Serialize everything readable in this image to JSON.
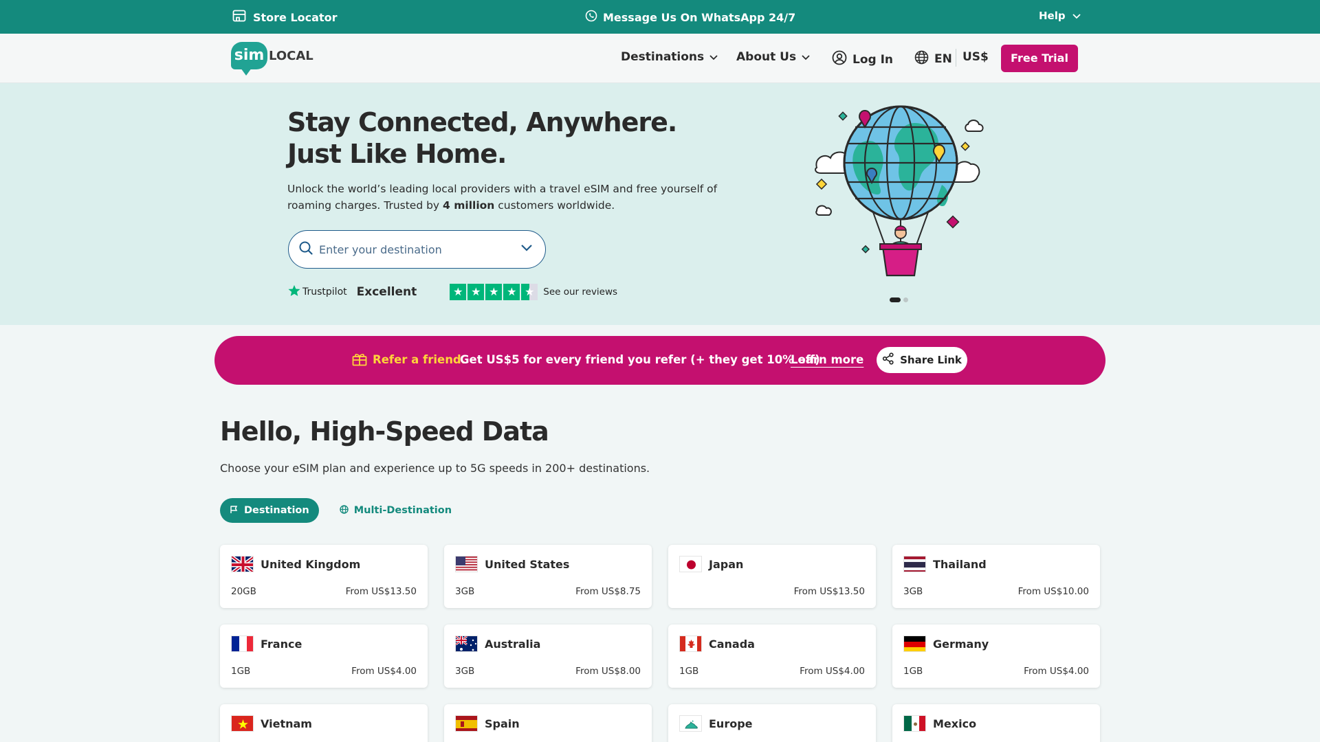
{
  "topbar": {
    "store_locator": "Store Locator",
    "whatsapp": "Message Us On WhatsApp 24/7",
    "help": "Help"
  },
  "nav": {
    "logo_sim": "sim",
    "logo_local": "LOCAL",
    "destinations": "Destinations",
    "about_us": "About Us",
    "log_in": "Log In",
    "language": "EN",
    "currency": "US$",
    "free_trial": "Free Trial"
  },
  "hero": {
    "title": "Stay Connected, Anywhere.  Just Like Home.",
    "sub_before": "Unlock the world’s leading local providers with a travel eSIM and free yourself of roaming charges. Trusted by ",
    "sub_bold": "4 million",
    "sub_after": " customers worldwide.",
    "search_placeholder": "Enter your destination",
    "trustpilot_brand": "Trustpilot",
    "trustpilot_rating": "Excellent",
    "trustpilot_stars": 4.5,
    "reviews_link": "See our reviews",
    "slides_total": 2,
    "slide_active": 1
  },
  "referral": {
    "label": "Refer a friend.",
    "text": "Get US$5 for every friend you refer  (+ they get 10% off)",
    "learn_more": "Learn more",
    "share": "Share Link"
  },
  "plans": {
    "title": "Hello, High-Speed Data",
    "subtitle": "Choose your eSIM plan and experience up to 5G speeds in 200+ destinations.",
    "tab_destination": "Destination",
    "tab_multi": "Multi-Destination",
    "cards": [
      {
        "name": "United Kingdom",
        "data": "20GB",
        "price": "From US$13.50",
        "flag": "uk"
      },
      {
        "name": "United States",
        "data": "3GB",
        "price": "From US$8.75",
        "flag": "us"
      },
      {
        "name": "Japan",
        "data": "",
        "price": "From US$13.50",
        "flag": "jp"
      },
      {
        "name": "Thailand",
        "data": "3GB",
        "price": "From US$10.00",
        "flag": "th"
      },
      {
        "name": "France",
        "data": "1GB",
        "price": "From US$4.00",
        "flag": "fr"
      },
      {
        "name": "Australia",
        "data": "3GB",
        "price": "From US$8.00",
        "flag": "au"
      },
      {
        "name": "Canada",
        "data": "1GB",
        "price": "From US$4.00",
        "flag": "ca"
      },
      {
        "name": "Germany",
        "data": "1GB",
        "price": "From US$4.00",
        "flag": "de"
      },
      {
        "name": "Vietnam",
        "data": "",
        "price": "",
        "flag": "vn"
      },
      {
        "name": "Spain",
        "data": "",
        "price": "",
        "flag": "es"
      },
      {
        "name": "Europe",
        "data": "",
        "price": "",
        "flag": "eu"
      },
      {
        "name": "Mexico",
        "data": "",
        "price": "",
        "flag": "mx"
      }
    ]
  },
  "colors": {
    "brand_teal": "#148a7d",
    "brand_magenta": "#c4106f",
    "hero_bg": "#dbefed",
    "referral_highlight": "#ffd53a",
    "trustpilot_green": "#00b67a"
  }
}
